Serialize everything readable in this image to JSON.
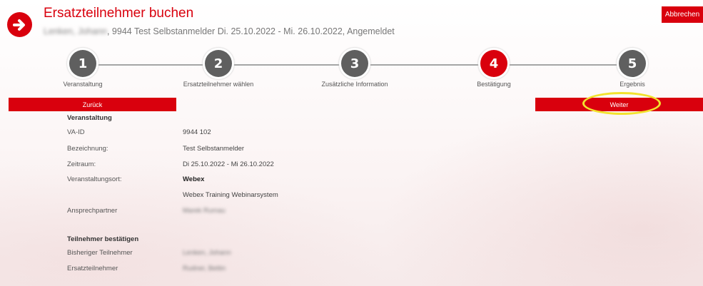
{
  "header": {
    "title": "Ersatzteilnehmer buchen",
    "subtitle_blurred": "Lenken, Johann",
    "subtitle_rest": ", 9944 Test Selbstanmelder Di. 25.10.2022 - Mi. 26.10.2022, Angemeldet",
    "cancel_label": "Abbrechen"
  },
  "steps": [
    {
      "number": "1",
      "label": "Veranstaltung",
      "active": false
    },
    {
      "number": "2",
      "label": "Ersatzteilnehmer wählen",
      "active": false
    },
    {
      "number": "3",
      "label": "Zusätzliche Information",
      "active": false
    },
    {
      "number": "4",
      "label": "Bestätigung",
      "active": true
    },
    {
      "number": "5",
      "label": "Ergebnis",
      "active": false
    }
  ],
  "nav": {
    "back_label": "Zurück",
    "next_label": "Weiter"
  },
  "event": {
    "section_title": "Veranstaltung",
    "fields": [
      {
        "label": "VA-ID",
        "value": "9944 102"
      },
      {
        "label": "Bezeichnung:",
        "value": "Test Selbstanmelder"
      },
      {
        "label": "Zeitraum:",
        "value": "Di 25.10.2022 - Mi 26.10.2022"
      },
      {
        "label": "Veranstaltungsort:",
        "value": "Webex"
      },
      {
        "label": "",
        "value": "Webex Training Webinarsystem"
      },
      {
        "label": "Ansprechpartner",
        "value": "Marek Rumau"
      }
    ]
  },
  "participants": {
    "section_title": "Teilnehmer bestätigen",
    "fields": [
      {
        "label": "Bisheriger Teilnehmer",
        "value": "Lenken, Johann"
      },
      {
        "label": "Ersatzteilnehmer",
        "value": "Rudner, Bettin"
      }
    ]
  },
  "colors": {
    "accent": "#d9000d",
    "step_inactive": "#5f5f5f",
    "highlight": "#f2e22e"
  }
}
